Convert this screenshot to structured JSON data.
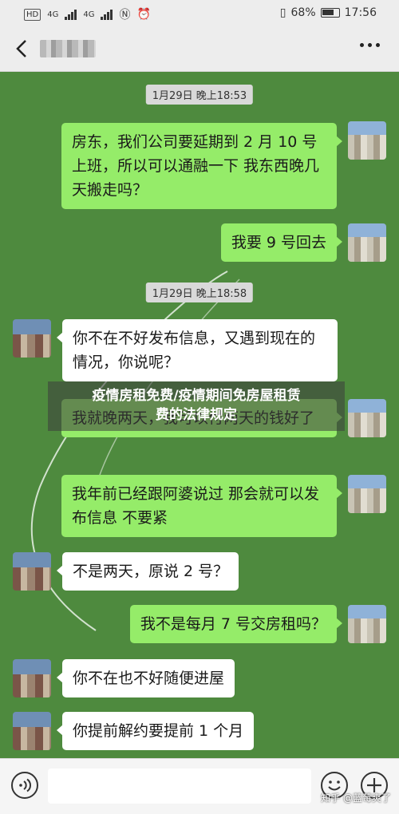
{
  "status_bar": {
    "left_chip": "HD",
    "net1": "4G",
    "net2": "4G",
    "battery_percent": "68%",
    "time": "17:56"
  },
  "chat": {
    "timestamps": [
      "1月29日 晚上18:53",
      "1月29日 晚上18:58"
    ],
    "messages": [
      {
        "side": "me",
        "text": "房东，我们公司要延期到 2 月 10 号上班，所以可以通融一下 我东西晚几天搬走吗？"
      },
      {
        "side": "me",
        "text": "我要 9 号回去"
      },
      {
        "side": "them",
        "text": "你不在不好发布信息，又遇到现在的情况，你说呢？"
      },
      {
        "side": "me",
        "text": "我就晚两天，我可以付两天的钱好了"
      },
      {
        "side": "me",
        "text": "我年前已经跟阿婆说过 那会就可以发布信息 不要紧"
      },
      {
        "side": "them",
        "text": "不是两天，原说 2 号？"
      },
      {
        "side": "me",
        "text": "我不是每月 7 号交房租吗？"
      },
      {
        "side": "them",
        "text": "你不在也不好随便进屋"
      },
      {
        "side": "them",
        "text": "你提前解约要提前 1 个月"
      }
    ]
  },
  "overlay": {
    "line1": "疫情房租免费/疫情期间免房屋租赁",
    "line2": "费的法律规定"
  },
  "watermark": "知乎 @蓝莓爽了"
}
